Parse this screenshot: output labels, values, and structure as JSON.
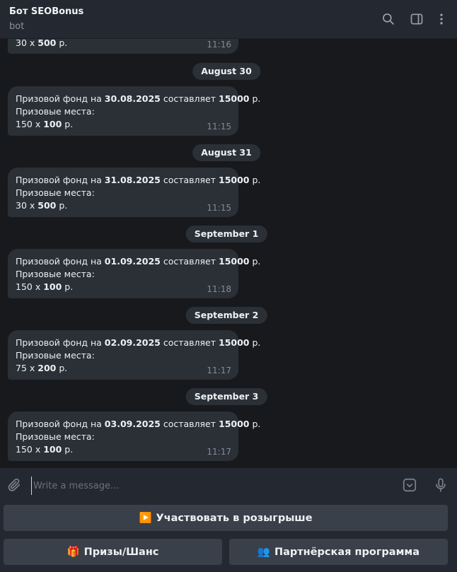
{
  "header": {
    "title": "Бот SEOBonus",
    "subtitle": "bot"
  },
  "messages": [
    {
      "partial": true,
      "line3": [
        "30 x ",
        "500",
        " р."
      ],
      "time": "11:16"
    },
    {
      "date": "August 30"
    },
    {
      "lead": "Призовой фонд на ",
      "date_val": "30.08.2025",
      "mid": " составляет ",
      "amount": "15000",
      "tail": " р.",
      "line2": "Призовые места:",
      "line3": [
        "150 x ",
        "100",
        " р."
      ],
      "time": "11:15"
    },
    {
      "date": "August 31"
    },
    {
      "lead": "Призовой фонд на ",
      "date_val": "31.08.2025",
      "mid": " составляет ",
      "amount": "15000",
      "tail": " р.",
      "line2": "Призовые места:",
      "line3": [
        "30 x ",
        "500",
        " р."
      ],
      "time": "11:15"
    },
    {
      "date": "September 1"
    },
    {
      "lead": "Призовой фонд на ",
      "date_val": "01.09.2025",
      "mid": " составляет ",
      "amount": "15000",
      "tail": " р.",
      "line2": "Призовые места:",
      "line3": [
        "150 x ",
        "100",
        " р."
      ],
      "time": "11:18"
    },
    {
      "date": "September 2"
    },
    {
      "lead": "Призовой фонд на ",
      "date_val": "02.09.2025",
      "mid": " составляет ",
      "amount": "15000",
      "tail": " р.",
      "line2": "Призовые места:",
      "line3": [
        "75 x ",
        "200",
        " р."
      ],
      "time": "11:17"
    },
    {
      "date": "September 3"
    },
    {
      "lead": "Призовой фонд на ",
      "date_val": "03.09.2025",
      "mid": " составляет ",
      "amount": "15000",
      "tail": " р.",
      "line2": "Призовые места:",
      "line3": [
        "150 x ",
        "100",
        " р."
      ],
      "time": "11:17"
    }
  ],
  "composer": {
    "placeholder": "Write a message..."
  },
  "keyboard": {
    "participate": {
      "emoji": "▶️",
      "label": "Участвовать в розыгрыше"
    },
    "prizes": {
      "emoji": "🎁",
      "label": "Призы/Шанс"
    },
    "partner": {
      "emoji": "👥",
      "label": "Партнёрская программа"
    }
  },
  "icons": {
    "search": "search-icon",
    "sidebar": "sidebar-toggle-icon",
    "more": "more-vertical-icon",
    "attach": "paperclip-icon",
    "bot_keyboard": "bot-keyboard-icon",
    "mic": "microphone-icon"
  },
  "colors": {
    "header_bg": "#232831",
    "chat_bg": "#17191d",
    "bubble_bg": "#2b3036",
    "button_bg": "#3a4049",
    "muted_text": "#838b96"
  }
}
